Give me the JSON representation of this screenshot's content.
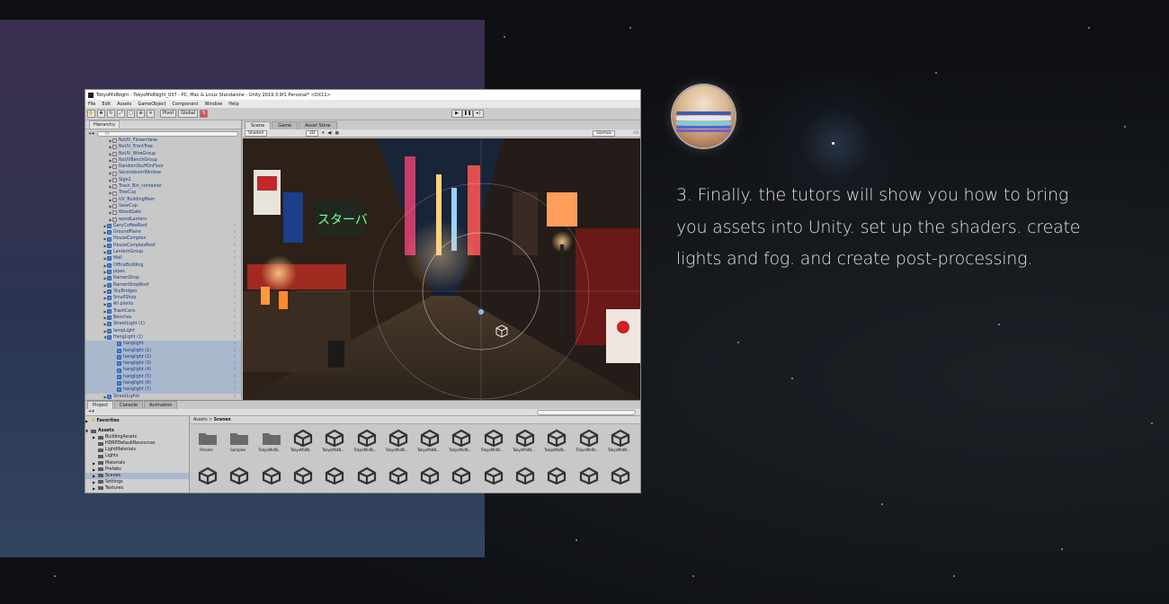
{
  "description": "3. Finally. the tutors will show you how to bring you assets into Unity. set up the shaders. create lights and fog. and create post-processing.",
  "colors": {
    "background": "#121417",
    "text": "#e2e2e2",
    "accent_blue": "#4a86d8"
  },
  "unity": {
    "window_title": "TokyoMidNight - TokyoMidNight_037 - PC, Mac & Linux Standalone - Unity 2019.3.9f1 Personal* <DX11>",
    "menu": [
      "File",
      "Edit",
      "Assets",
      "GameObject",
      "Component",
      "Window",
      "Help"
    ],
    "toolbar": {
      "pivot": "Pivot",
      "global": "Global"
    },
    "hierarchy": {
      "tab": "Hierarchy",
      "search_placeholder": "All",
      "items": [
        "NoUV_FlowerVase",
        "NoUV_FrontTree",
        "NoUV_WireGroup",
        "NoUVBenchGroup",
        "RandomStuffOnFloor",
        "SecondoomWindow",
        "Sign2",
        "Trash_Bin_container",
        "TreeCup",
        "UV_BuildingMain",
        "VaseCup",
        "WoodGate",
        "woodLantern",
        "GaryCoffeeRoof",
        "GroundPlane",
        "HouseComplex",
        "HouseComplexRoof",
        "LanternGroup",
        "Mall",
        "OfficeBuilding",
        "pipes",
        "RamenShop",
        "RamenShopRoof",
        "SkyBridges",
        "SmallShop",
        "All plants",
        "TrashCans",
        "Benches",
        "StreetLight (1)",
        "lampLight",
        "HangLight (1)",
        "hanglight",
        "hanglight (1)",
        "hanglight (2)",
        "hanglight (3)",
        "hanglight (4)",
        "hanglight (5)",
        "hanglight (6)",
        "hanglight (7)",
        "StreetLights"
      ]
    },
    "scene_tabs": [
      "Scene",
      "Game",
      "Asset Store"
    ],
    "scene_toolbar": {
      "shading_mode": "Shaded",
      "mode_2d": "2D",
      "gizmos": "Gizmos",
      "search_all": "All"
    },
    "bottom_tabs": [
      "Project",
      "Console",
      "Animation"
    ],
    "project_tree": {
      "favorites": "Favorites",
      "assets": "Assets",
      "folders": [
        "BuildingAssets",
        "HDRPDefaultResources",
        "LightMaterials",
        "Lights",
        "Materials",
        "Prefabs",
        "Scenes",
        "Settings",
        "Textures"
      ]
    },
    "breadcrumb": {
      "root": "Assets",
      "current": "Scenes"
    },
    "asset_labels": [
      "Presets",
      "Samples",
      "TokyoMidN...",
      "TokyoMidN...",
      "TokyoMidN...",
      "TokyoMidN...",
      "TokyoMidN...",
      "TokyoMidN...",
      "TokyoMidN...",
      "TokyoMidN...",
      "TokyoMidN...",
      "TokyoMidN...",
      "TokyoMidN...",
      "TokyoMidN..."
    ]
  }
}
